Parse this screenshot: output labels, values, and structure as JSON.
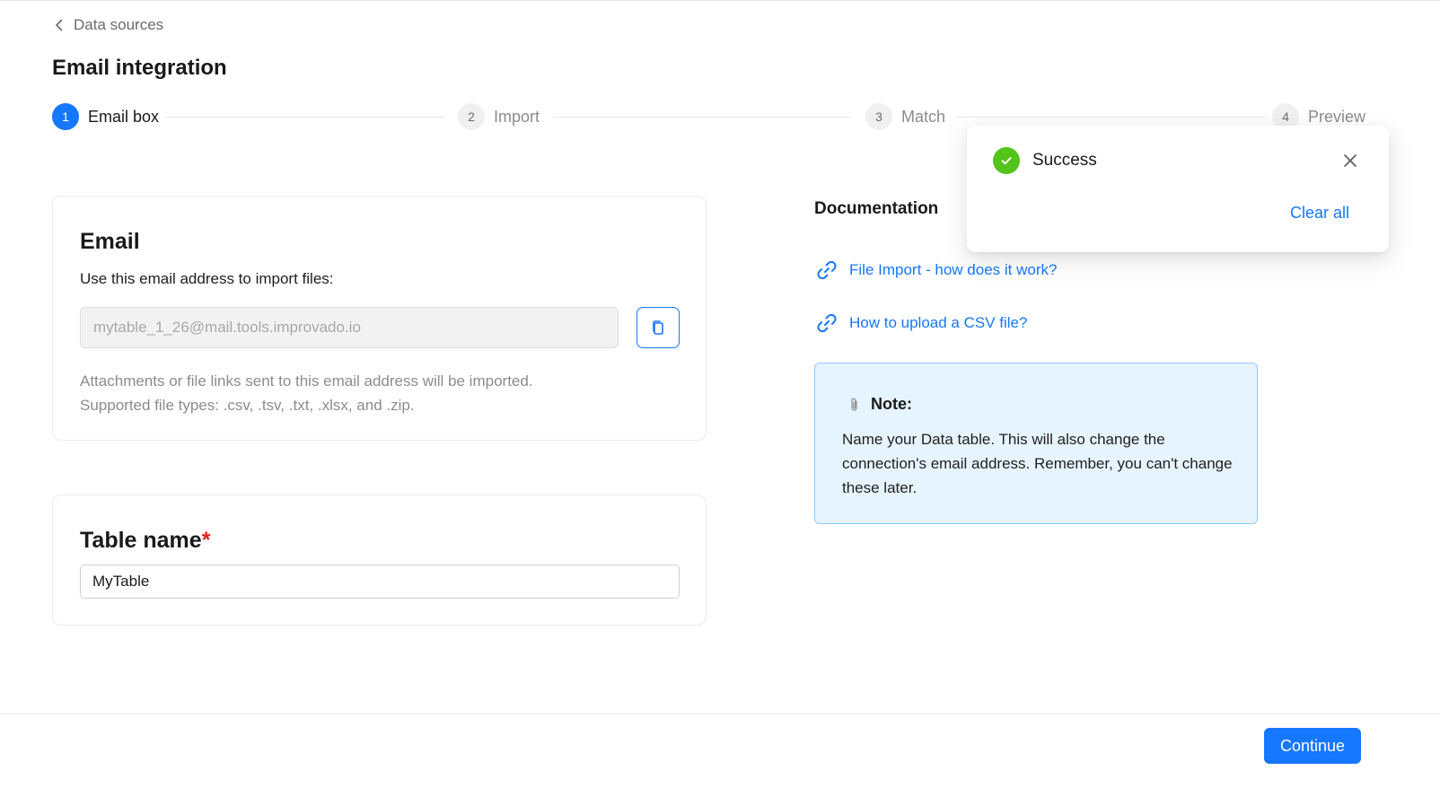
{
  "nav": {
    "back_label": "Data sources"
  },
  "page": {
    "title": "Email integration"
  },
  "stepper": {
    "steps": [
      {
        "num": "1",
        "label": "Email box",
        "state": "active"
      },
      {
        "num": "2",
        "label": "Import",
        "state": "inactive"
      },
      {
        "num": "3",
        "label": "Match",
        "state": "inactive"
      },
      {
        "num": "4",
        "label": "Preview",
        "state": "inactive"
      }
    ]
  },
  "email_card": {
    "title": "Email",
    "description": "Use this email address to import files:",
    "email_value": "mytable_1_26@mail.tools.improvado.io",
    "hint_line1": "Attachments or file links sent to this email address will be imported.",
    "hint_line2": "Supported file types: .csv, .tsv, .txt, .xlsx, and .zip.",
    "copy_icon": "copy-icon"
  },
  "table_card": {
    "title": "Table name",
    "required_mark": "*",
    "value": "MyTable"
  },
  "documentation": {
    "title": "Documentation",
    "links": [
      {
        "label": "File Import - how does it work?",
        "icon": "link-icon"
      },
      {
        "label": "How to upload a CSV file?",
        "icon": "link-icon"
      }
    ]
  },
  "note": {
    "title": "Note:",
    "icon": "paperclip-icon",
    "text": "Name your Data table. This will also change the connection's email address. Remember, you can't change these later."
  },
  "toast": {
    "title": "Success",
    "clear_label": "Clear all",
    "icon": "check-circle-icon"
  },
  "footer": {
    "continue_label": "Continue"
  },
  "colors": {
    "primary": "#1677ff",
    "success": "#52c41a",
    "note_bg": "#e6f4ff",
    "required": "#e02020"
  }
}
